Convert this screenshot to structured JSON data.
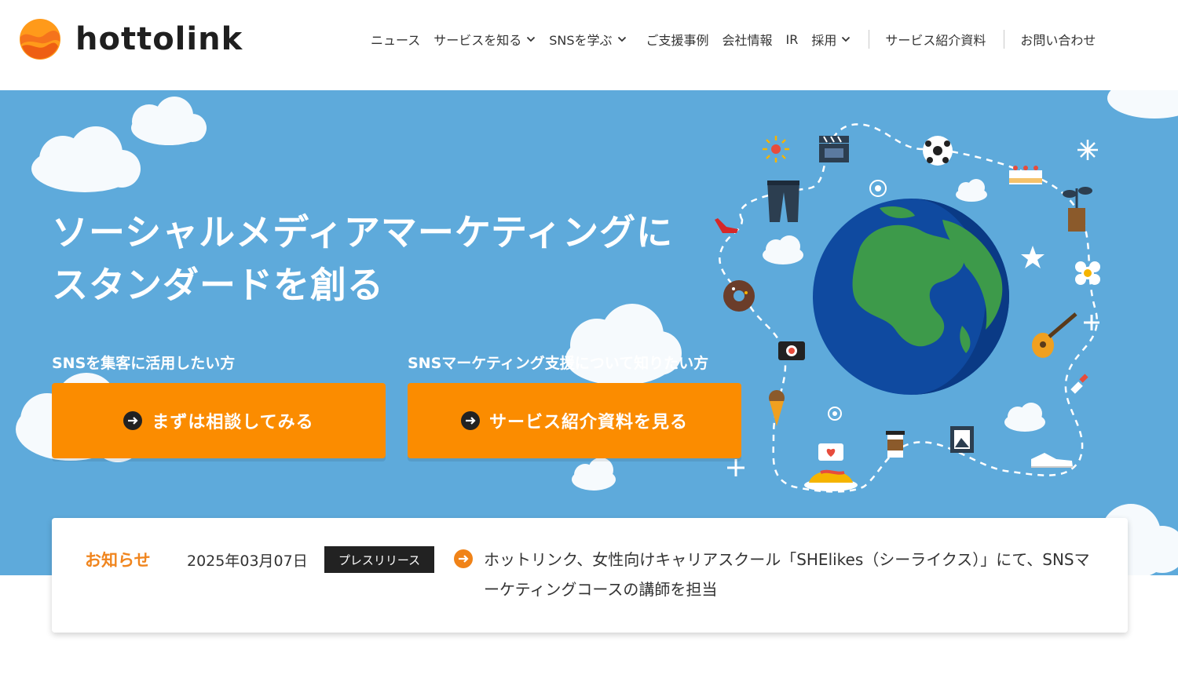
{
  "brand": {
    "name": "hottolink",
    "color": "#f08318"
  },
  "nav": {
    "items": [
      {
        "label": "ニュース",
        "dropdown": false
      },
      {
        "label": "サービスを知る",
        "dropdown": true
      },
      {
        "label": "SNSを学ぶ",
        "dropdown": true
      },
      {
        "label": "ご支援事例",
        "dropdown": false
      },
      {
        "label": "会社情報",
        "dropdown": false
      },
      {
        "label": "IR",
        "dropdown": false
      },
      {
        "label": "採用",
        "dropdown": true
      }
    ],
    "document_link": "サービス紹介資料",
    "contact_link": "お問い合わせ"
  },
  "hero": {
    "title_line1": "ソーシャルメディアマーケティングに",
    "title_line2": "スタンダードを創る",
    "background": "#5eaadb",
    "cta_left": {
      "label": "SNSを集客に活用したい方",
      "button": "まずは相談してみる",
      "icon": "arrow-right-circle-icon"
    },
    "cta_right": {
      "label": "SNSマーケティング支援について知りたい方",
      "button": "サービス紹介資料を見る",
      "icon": "arrow-right-circle-icon"
    },
    "button_color": "#fb8c00"
  },
  "news": {
    "label": "お知らせ",
    "date": "2025年03月07日",
    "tag": "プレスリリース",
    "headline": "ホットリンク、女性向けキャリアスクール「SHElikes（シーライクス）」にて、SNSマーケティングコースの講師を担当",
    "icon": "arrow-right-circle-icon"
  }
}
